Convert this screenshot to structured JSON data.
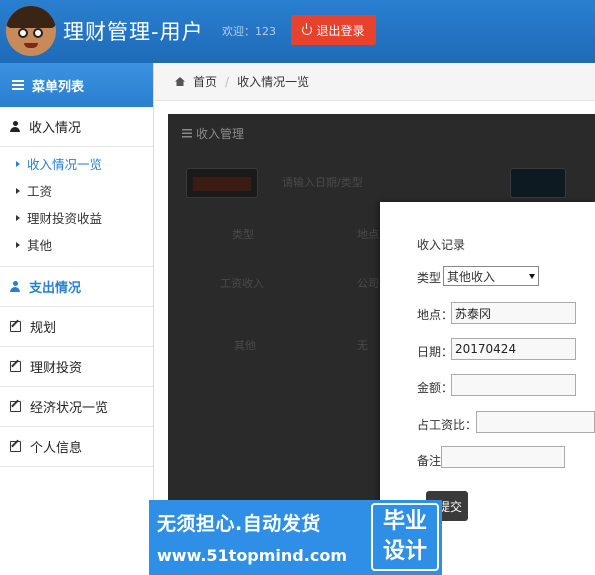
{
  "header": {
    "app_title": "理财管理-用户",
    "welcome": "欢迎：123",
    "logout_label": "退出登录"
  },
  "sidebar": {
    "menu_title": "菜单列表",
    "income_group": "收入情况",
    "income_items": [
      "收入情况一览",
      "工资",
      "理财投资收益",
      "其他"
    ],
    "expense_group": "支出情况",
    "plan": "规划",
    "invest": "理财投资",
    "economy": "经济状况一览",
    "personal": "个人信息"
  },
  "breadcrumb": {
    "home": "首页",
    "current": "收入情况一览"
  },
  "panel": {
    "title": "收入管理",
    "search_hint": "请输入日期/类型",
    "col_type": "类型",
    "col_place": "地点",
    "row1_type": "工资收入",
    "row1_place": "公司",
    "row2_type": "其他",
    "row2_place": "无"
  },
  "modal": {
    "title": "收入记录",
    "type_label": "类型",
    "type_value": "其他收入",
    "place_label": "地点：",
    "place_value": "苏泰冈",
    "date_label": "日期：",
    "date_value": "20170424",
    "amount_label": "金额：",
    "ratio_label": "占工资比：",
    "note_label": "备注",
    "submit_label": "提交"
  },
  "watermark": {
    "line1": "无须担心.自动发货",
    "line2": "www.51topmind.com",
    "box_top": "毕业",
    "box_bottom": "设计"
  }
}
